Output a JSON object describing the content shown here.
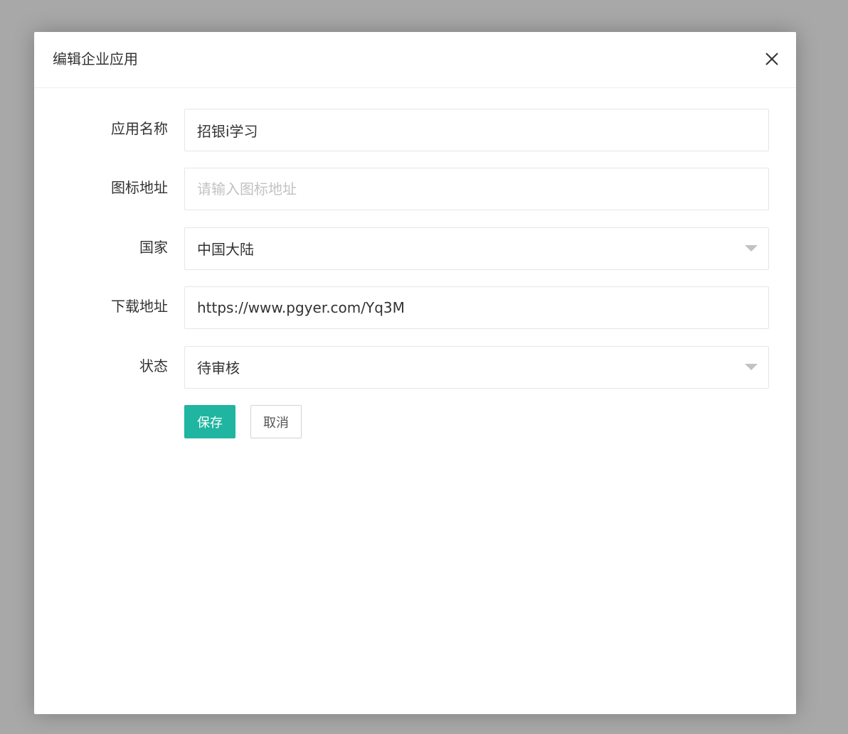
{
  "dialog": {
    "title": "编辑企业应用",
    "close_icon": "close-icon"
  },
  "form": {
    "app_name": {
      "label": "应用名称",
      "value": "招银i学习",
      "placeholder": ""
    },
    "icon_url": {
      "label": "图标地址",
      "value": "",
      "placeholder": "请输入图标地址"
    },
    "country": {
      "label": "国家",
      "selected": "中国大陆",
      "icon": "chevron-down-icon"
    },
    "download_url": {
      "label": "下载地址",
      "value": "https://www.pgyer.com/Yq3M",
      "placeholder": ""
    },
    "status": {
      "label": "状态",
      "selected": "待审核",
      "icon": "chevron-down-icon"
    }
  },
  "actions": {
    "save_label": "保存",
    "cancel_label": "取消"
  },
  "colors": {
    "primary": "#1fb5a0",
    "overlay": "#a8a8a8",
    "text": "#333333",
    "placeholder": "#c2c2c2",
    "border": "#e6e6e6"
  }
}
